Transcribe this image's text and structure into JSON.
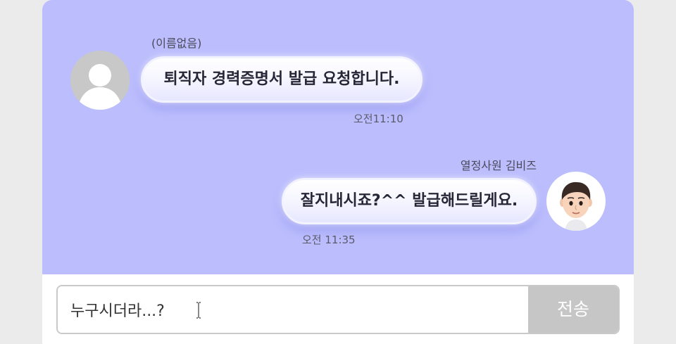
{
  "colors": {
    "chat_background": "#bbbdfd",
    "bubble": "#f4f4ff",
    "send_button": "#c6c6c6",
    "page_background": "#ebebeb"
  },
  "messages": [
    {
      "sender": "(이름없음)",
      "text": "퇴직자 경력증명서 발급 요청합니다.",
      "time": "오전11:10",
      "avatar": "default-person-icon"
    },
    {
      "sender": "열정사원 김비즈",
      "text": "잘지내시죠?^^ 발급해드릴게요.",
      "time": "오전 11:35",
      "avatar": "user-avatar-icon"
    }
  ],
  "composer": {
    "value": "누구시더라...?",
    "send_label": "전송"
  }
}
